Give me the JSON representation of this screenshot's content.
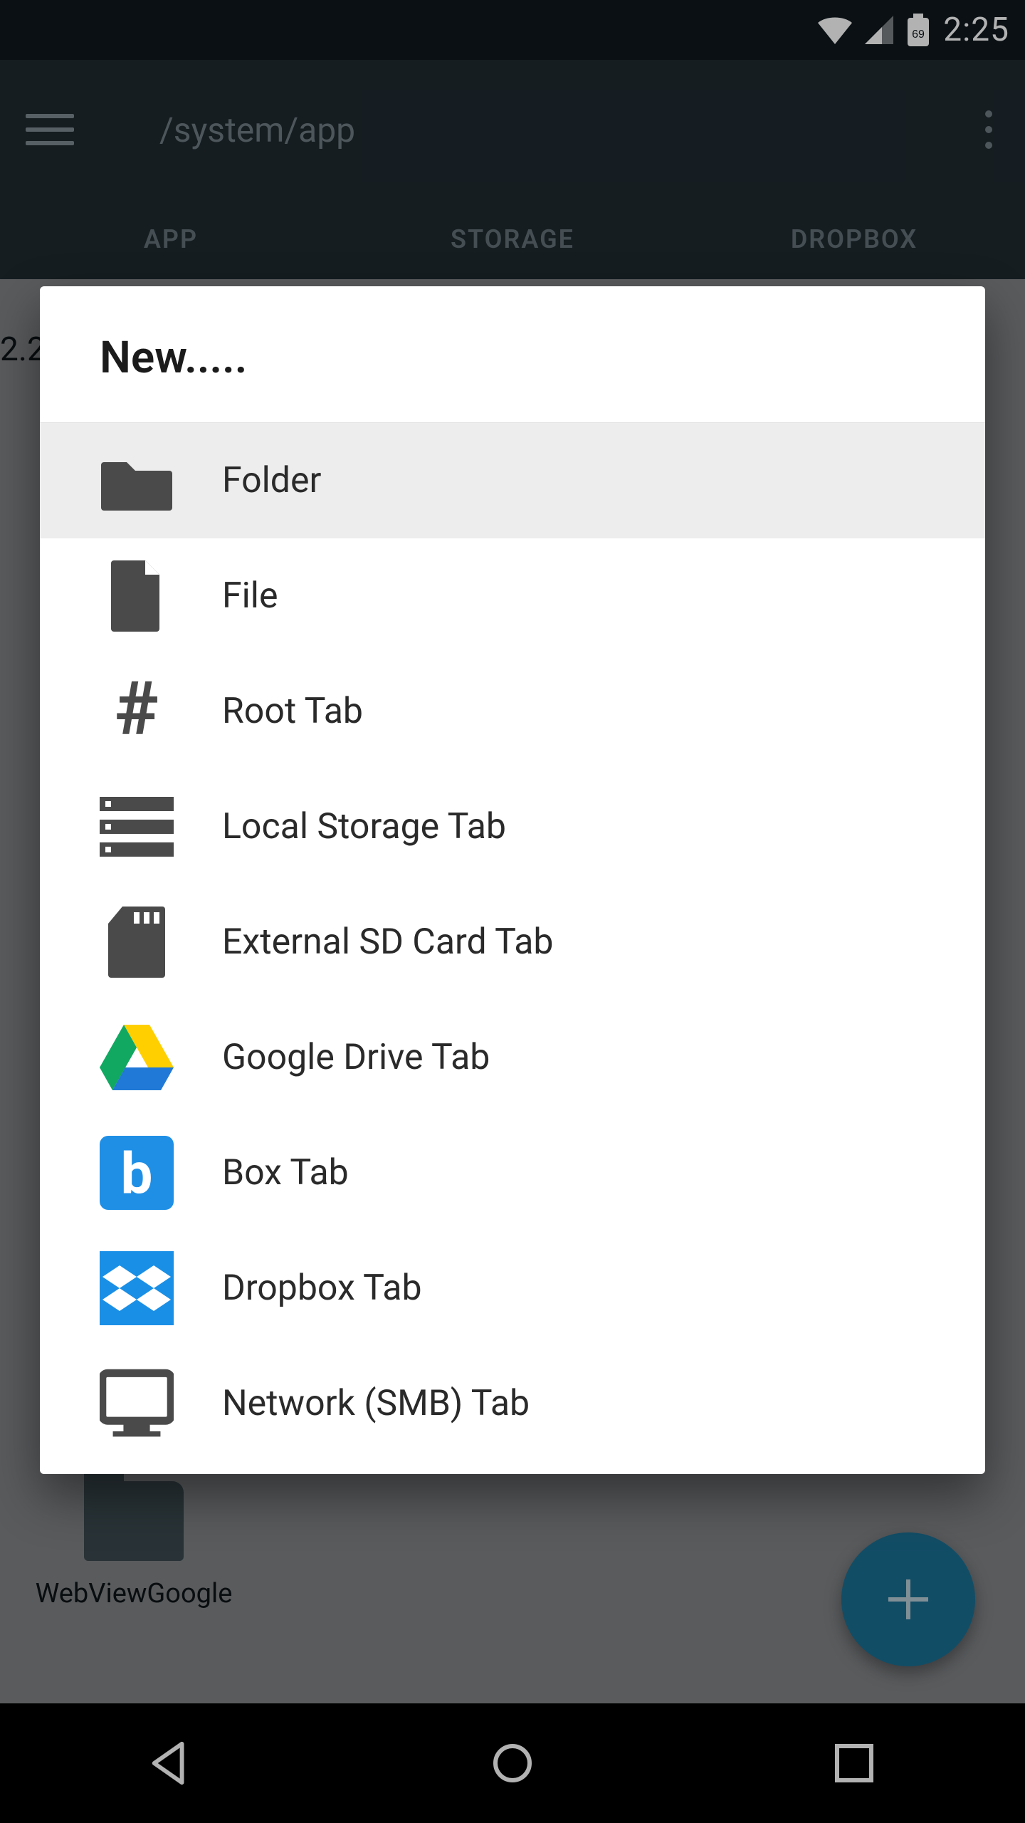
{
  "statusbar": {
    "time": "2:25",
    "battery": "69"
  },
  "appbar": {
    "path": "/system/app"
  },
  "tabs": [
    {
      "id": "app",
      "label": "APP"
    },
    {
      "id": "storage",
      "label": "STORAGE"
    },
    {
      "id": "dropbox",
      "label": "DROPBOX"
    }
  ],
  "background": {
    "leading_text": "2.2",
    "item_label": "WebViewGoogle"
  },
  "dialog": {
    "title": "New.....",
    "items": [
      {
        "id": "folder",
        "label": "Folder",
        "icon": "folder-icon",
        "selected": true
      },
      {
        "id": "file",
        "label": "File",
        "icon": "file-icon",
        "selected": false
      },
      {
        "id": "root-tab",
        "label": "Root Tab",
        "icon": "hash-icon",
        "selected": false
      },
      {
        "id": "local-storage",
        "label": "Local Storage Tab",
        "icon": "storage-icon",
        "selected": false
      },
      {
        "id": "sd-card",
        "label": "External SD Card Tab",
        "icon": "sd-card-icon",
        "selected": false
      },
      {
        "id": "gdrive",
        "label": "Google Drive Tab",
        "icon": "gdrive-icon",
        "selected": false
      },
      {
        "id": "box",
        "label": "Box Tab",
        "icon": "box-icon",
        "selected": false
      },
      {
        "id": "dropbox",
        "label": "Dropbox Tab",
        "icon": "dropbox-icon",
        "selected": false
      },
      {
        "id": "smb",
        "label": "Network (SMB) Tab",
        "icon": "monitor-icon",
        "selected": false
      }
    ]
  }
}
